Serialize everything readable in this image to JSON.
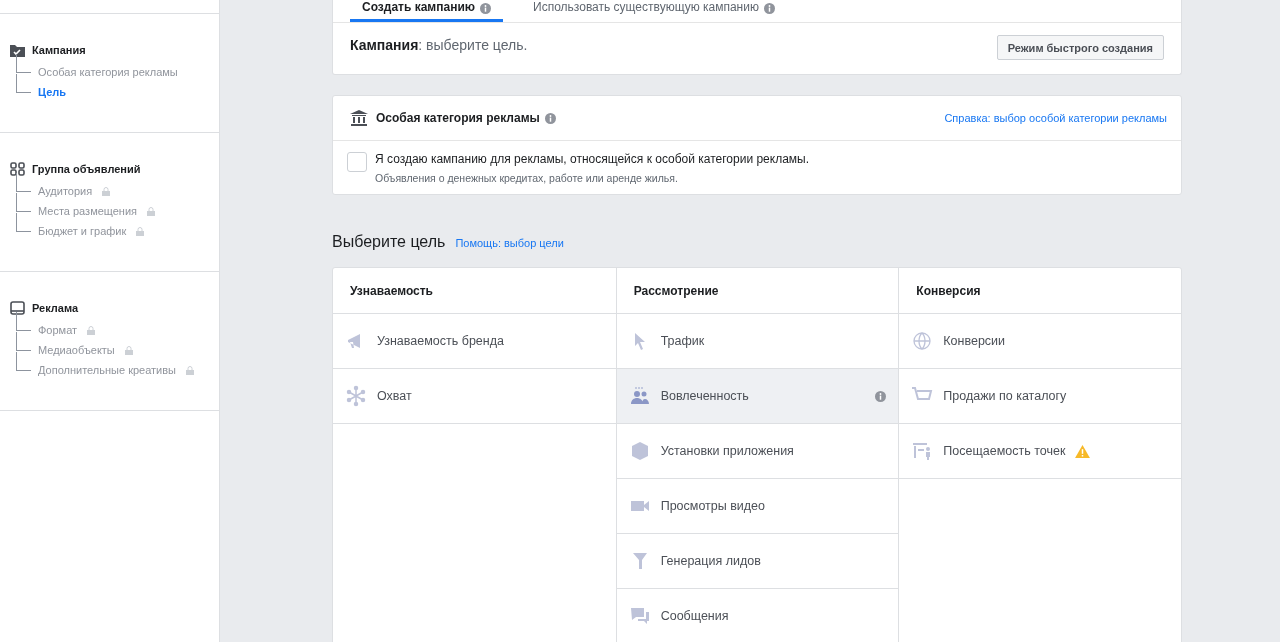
{
  "sidebar": {
    "sections": [
      {
        "title": "Кампания",
        "items": [
          {
            "label": "Особая категория рекламы",
            "selected": false,
            "locked": false
          },
          {
            "label": "Цель",
            "selected": true,
            "locked": false
          }
        ]
      },
      {
        "title": "Группа объявлений",
        "items": [
          {
            "label": "Аудитория",
            "selected": false,
            "locked": true
          },
          {
            "label": "Места размещения",
            "selected": false,
            "locked": true
          },
          {
            "label": "Бюджет и график",
            "selected": false,
            "locked": true
          }
        ]
      },
      {
        "title": "Реклама",
        "items": [
          {
            "label": "Формат",
            "selected": false,
            "locked": true
          },
          {
            "label": "Медиаобъекты",
            "selected": false,
            "locked": true
          },
          {
            "label": "Дополнительные креативы",
            "selected": false,
            "locked": true
          }
        ]
      }
    ]
  },
  "tabs": [
    {
      "label": "Создать кампанию",
      "selected": true
    },
    {
      "label": "Использовать существующую кампанию",
      "selected": false
    }
  ],
  "campaign": {
    "label": "Кампания",
    "text": ": выберите цель.",
    "button": "Режим быстрого создания"
  },
  "special_category": {
    "title": "Особая категория рекламы",
    "help_link": "Справка: выбор особой категории рекламы",
    "checkbox": {
      "label": "Я создаю кампанию для рекламы, относящейся к особой категории рекламы.",
      "hint": "Объявления о денежных кредитах, работе или аренде жилья.",
      "checked": false
    }
  },
  "objective": {
    "heading": "Выберите цель",
    "help_link": "Помощь: выбор цели",
    "columns": [
      {
        "title": "Узнаваемость",
        "items": [
          {
            "label": "Узнаваемость бренда",
            "selected": false,
            "info": false,
            "warning": false
          },
          {
            "label": "Охват",
            "selected": false,
            "info": false,
            "warning": false
          }
        ]
      },
      {
        "title": "Рассмотрение",
        "items": [
          {
            "label": "Трафик",
            "selected": false,
            "info": false,
            "warning": false
          },
          {
            "label": "Вовлеченность",
            "selected": true,
            "info": true,
            "warning": false
          },
          {
            "label": "Установки приложения",
            "selected": false,
            "info": false,
            "warning": false
          },
          {
            "label": "Просмотры видео",
            "selected": false,
            "info": false,
            "warning": false
          },
          {
            "label": "Генерация лидов",
            "selected": false,
            "info": false,
            "warning": false
          },
          {
            "label": "Сообщения",
            "selected": false,
            "info": false,
            "warning": false
          }
        ]
      },
      {
        "title": "Конверсия",
        "items": [
          {
            "label": "Конверсии",
            "selected": false,
            "info": false,
            "warning": false
          },
          {
            "label": "Продажи по каталогу",
            "selected": false,
            "info": false,
            "warning": false
          },
          {
            "label": "Посещаемость точек",
            "selected": false,
            "info": false,
            "warning": true
          }
        ]
      }
    ]
  }
}
